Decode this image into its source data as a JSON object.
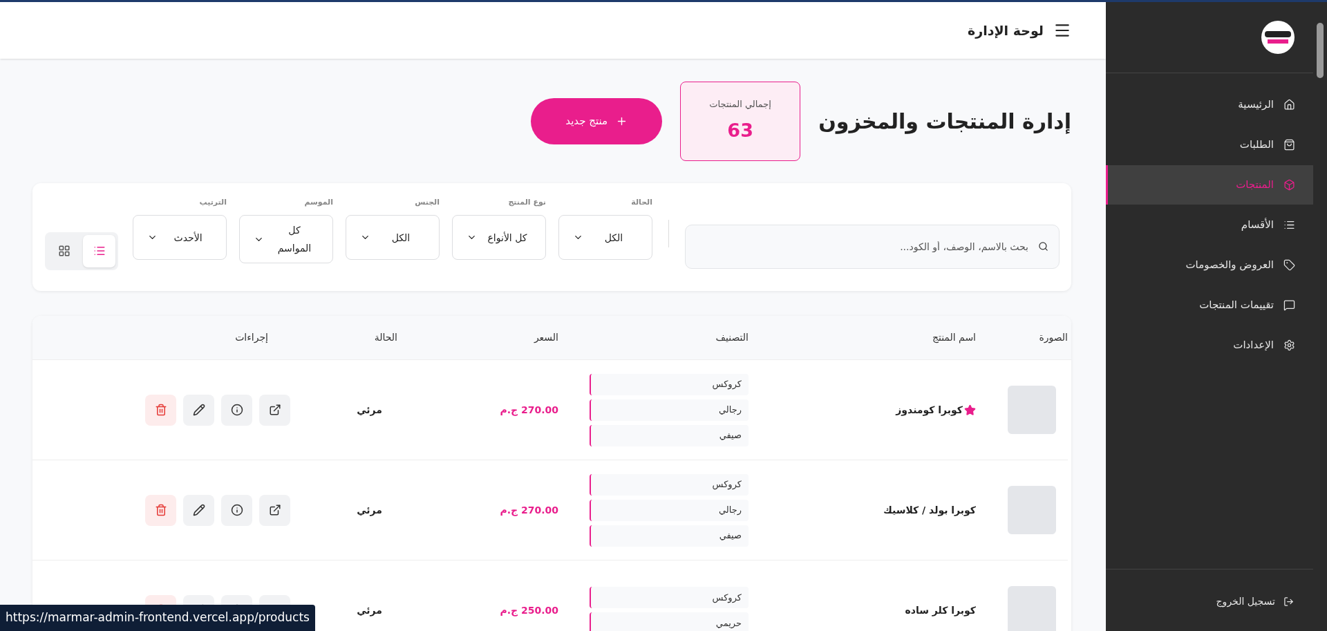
{
  "sidebar": {
    "items": [
      {
        "label": "الرئيسية",
        "selected": false
      },
      {
        "label": "الطلبات",
        "selected": false
      },
      {
        "label": "المنتجات",
        "selected": true
      },
      {
        "label": "الأقسام",
        "selected": false
      },
      {
        "label": "العروض والخصومات",
        "selected": false
      },
      {
        "label": "تقييمات المنتجات",
        "selected": false
      },
      {
        "label": "الإعدادات",
        "selected": false
      }
    ],
    "logout": "تسجيل الخروج"
  },
  "header": {
    "title": "لوحة الإدارة"
  },
  "page": {
    "title": "إدارة المنتجات والمخزون",
    "stat": {
      "label": "إجمالي المنتجات",
      "value": "63"
    },
    "new_button": "منتج جديد"
  },
  "filters": {
    "search": {
      "placeholder": "بحث بالاسم، الوصف، أو الكود..."
    },
    "selects": [
      {
        "label": "الحالة",
        "value": "الكل"
      },
      {
        "label": "نوع المنتج",
        "value": "كل الأنواع"
      },
      {
        "label": "الجنس",
        "value": "الكل"
      },
      {
        "label": "الموسم",
        "value": "كل المواسم"
      },
      {
        "label": "الترتيب",
        "value": "الأحدث"
      }
    ],
    "view_toggle": [
      {
        "kind": "list",
        "selected": true
      },
      {
        "kind": "grid",
        "selected": false
      }
    ]
  },
  "table": {
    "columns": [
      "الصورة",
      "اسم المنتج",
      "التصنيف",
      "السعر",
      "الحالة",
      "إجراءات"
    ],
    "rows": [
      {
        "name": "كوبرا كومندوز",
        "featured": true,
        "categories": [
          "كروكس",
          "رجالي",
          "صيفي"
        ],
        "price": "270.00 ج.م",
        "status": "مرئي"
      },
      {
        "name": "كوبرا بولد / كلاسيك",
        "featured": false,
        "categories": [
          "كروكس",
          "رجالي",
          "صيفي"
        ],
        "price": "270.00 ج.م",
        "status": "مرئي"
      },
      {
        "name": "كوبرا كلر ساده",
        "featured": false,
        "categories": [
          "كروكس",
          "حريمي"
        ],
        "price": "250.00 ج.م",
        "status": "مرئي"
      }
    ]
  },
  "status_url": "https://marmar-admin-frontend.vercel.app/products"
}
